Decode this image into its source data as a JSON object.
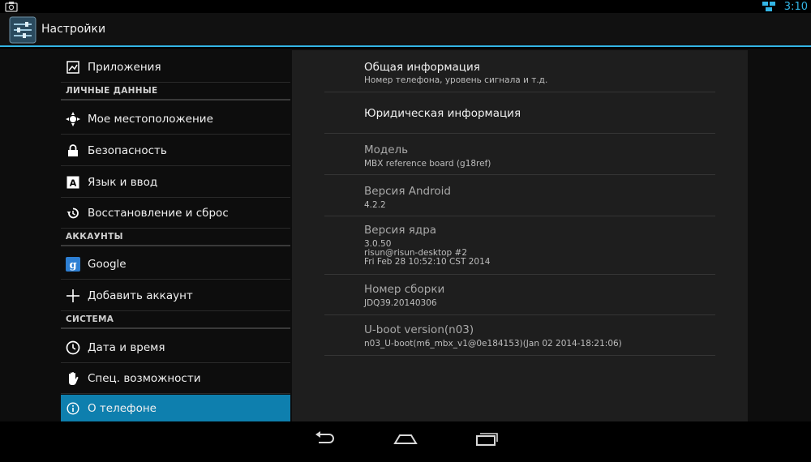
{
  "status_bar": {
    "clock": "3:10"
  },
  "action_bar": {
    "title": "Настройки",
    "icon": "settings-sliders-icon"
  },
  "sidebar": {
    "items": [
      {
        "label": "Приложения",
        "icon": "apps-icon"
      },
      {
        "section": "ЛИЧНЫЕ ДАННЫЕ"
      },
      {
        "label": "Мое местоположение",
        "icon": "location-icon"
      },
      {
        "label": "Безопасность",
        "icon": "lock-icon"
      },
      {
        "label": "Язык и ввод",
        "icon": "keyboard-a-icon"
      },
      {
        "label": "Восстановление и сброс",
        "icon": "restore-icon"
      },
      {
        "section": "АККАУНТЫ"
      },
      {
        "label": "Google",
        "icon": "google-icon"
      },
      {
        "label": "Добавить аккаунт",
        "icon": "plus-icon"
      },
      {
        "section": "СИСТЕМА"
      },
      {
        "label": "Дата и время",
        "icon": "clock-icon"
      },
      {
        "label": "Спец. возможности",
        "icon": "hand-icon"
      },
      {
        "label": "О телефоне",
        "icon": "info-icon",
        "selected": true
      }
    ]
  },
  "about": {
    "rows": [
      {
        "title": "Общая информация",
        "subs": [
          "Номер телефона, уровень сигнала и т.д."
        ]
      },
      {
        "title": "Юридическая информация",
        "subs": []
      },
      {
        "title": "Модель",
        "subs": [
          "MBX reference board (g18ref)"
        ]
      },
      {
        "title": "Версия Android",
        "subs": [
          "4.2.2"
        ]
      },
      {
        "title": "Версия ядра",
        "subs": [
          "3.0.50",
          "risun@risun-desktop #2",
          "Fri Feb 28 10:52:10 CST 2014"
        ]
      },
      {
        "title": "Номер сборки",
        "subs": [
          "JDQ39.20140306"
        ]
      },
      {
        "title": "U-boot version(n03)",
        "subs": [
          "n03_U-boot(m6_mbx_v1@0e184153)(Jan 02 2014-18:21:06)"
        ]
      }
    ]
  },
  "colors": {
    "accent": "#33b5e5",
    "selected_bg": "#0e7fae",
    "panel_bg": "#1e1e1e"
  }
}
